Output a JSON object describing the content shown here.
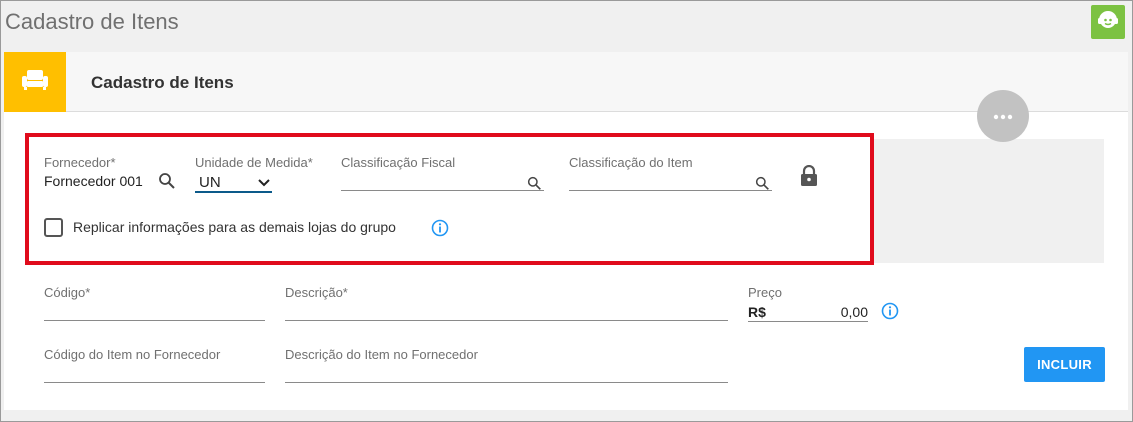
{
  "app": {
    "title": "Cadastro de Itens"
  },
  "panel": {
    "title": "Cadastro de Itens"
  },
  "colors": {
    "accent_yellow": "#ffbf00",
    "help_green": "#7cc242",
    "highlight_red": "#e00b1c",
    "primary_blue": "#2196f3"
  },
  "icons": {
    "header": "armchair-icon",
    "help": "support-chat-icon",
    "more": "more-dots-icon",
    "lock": "lock-icon",
    "search": "search-icon",
    "info": "info-icon"
  },
  "form": {
    "fornecedor": {
      "label": "Fornecedor*",
      "value": "Fornecedor 001"
    },
    "unidade": {
      "label": "Unidade de Medida*",
      "value": "UN"
    },
    "classificacao_fiscal": {
      "label": "Classificação Fiscal",
      "value": ""
    },
    "classificacao_item": {
      "label": "Classificação do Item",
      "value": ""
    },
    "replicar": {
      "label": "Replicar informações para as demais lojas do grupo",
      "checked": false
    },
    "codigo": {
      "label": "Código*",
      "value": ""
    },
    "descricao": {
      "label": "Descrição*",
      "value": ""
    },
    "preco": {
      "label": "Preço",
      "currency": "R$",
      "value": "0,00"
    },
    "codigo_fornecedor": {
      "label": "Código do Item no Fornecedor",
      "value": ""
    },
    "descricao_fornecedor": {
      "label": "Descrição do Item no Fornecedor",
      "value": ""
    },
    "incluir_label": "INCLUIR"
  }
}
